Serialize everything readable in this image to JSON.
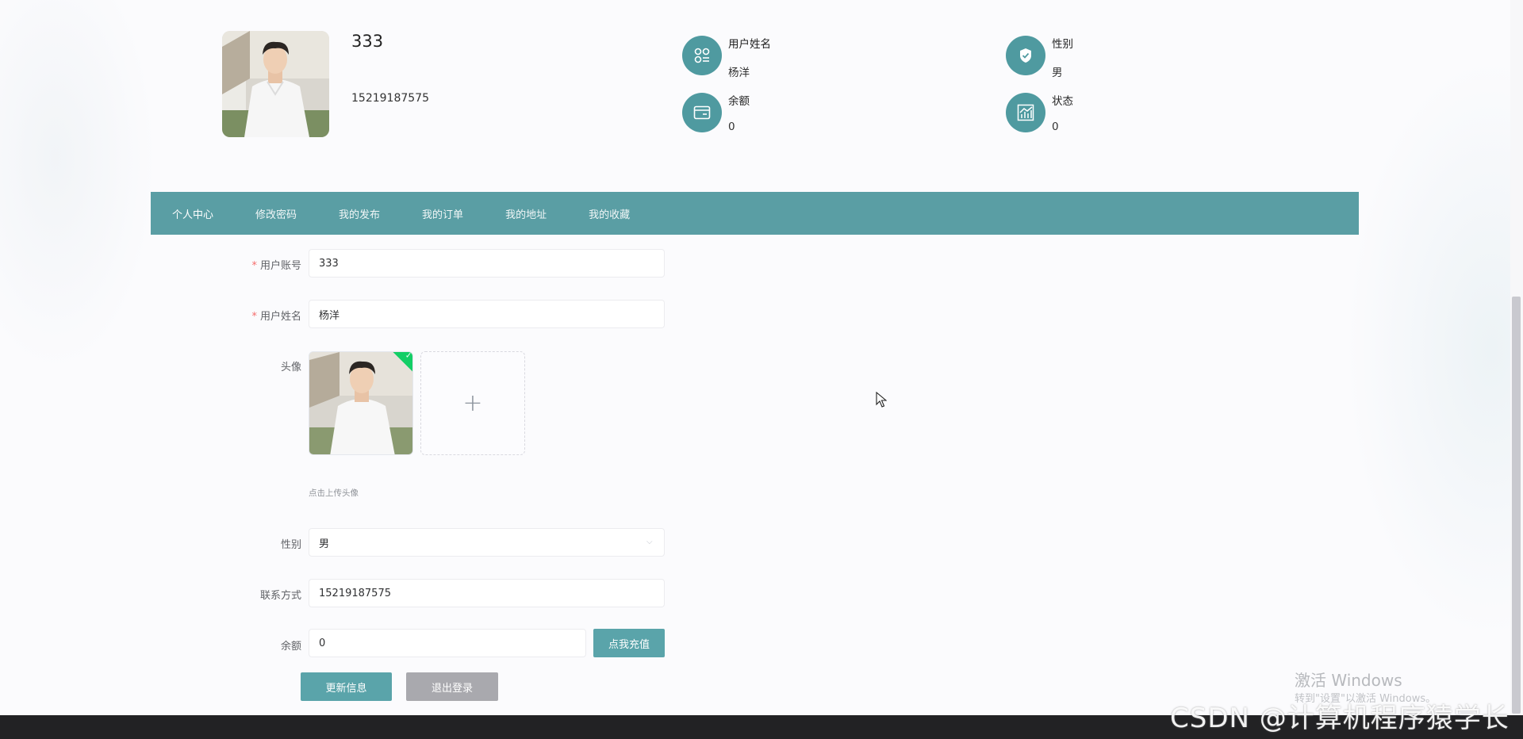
{
  "profile": {
    "name": "333",
    "phone": "15219187575",
    "stats": [
      {
        "label": "用户姓名",
        "value": "杨洋",
        "icon": "user-grid-icon"
      },
      {
        "label": "性别",
        "value": "男",
        "icon": "shield-check-icon"
      },
      {
        "label": "余额",
        "value": "0",
        "icon": "wallet-icon"
      },
      {
        "label": "状态",
        "value": "0",
        "icon": "chart-icon"
      }
    ]
  },
  "nav": {
    "items": [
      {
        "label": "个人中心",
        "active": true
      },
      {
        "label": "修改密码"
      },
      {
        "label": "我的发布"
      },
      {
        "label": "我的订单"
      },
      {
        "label": "我的地址"
      },
      {
        "label": "我的收藏"
      }
    ]
  },
  "form": {
    "account": {
      "label": "用户账号",
      "value": "333",
      "required": true
    },
    "username": {
      "label": "用户姓名",
      "value": "杨洋",
      "required": true
    },
    "avatar": {
      "label": "头像",
      "hint": "点击上传头像"
    },
    "gender": {
      "label": "性别",
      "value": "男"
    },
    "contact": {
      "label": "联系方式",
      "value": "15219187575"
    },
    "balance": {
      "label": "余额",
      "value": "0"
    },
    "recharge_label": "点我充值",
    "update_label": "更新信息",
    "logout_label": "退出登录"
  },
  "overlay": {
    "activate_title": "激活 Windows",
    "activate_sub": "转到\"设置\"以激活 Windows。",
    "watermark": "CSDN @计算机程序猿学长"
  },
  "colors": {
    "accent": "#5a9ea4",
    "icon_bg": "#4f9aa0",
    "button": "#5aa4aa",
    "logout_button": "#a9a9ae",
    "required": "#f56c6c"
  }
}
